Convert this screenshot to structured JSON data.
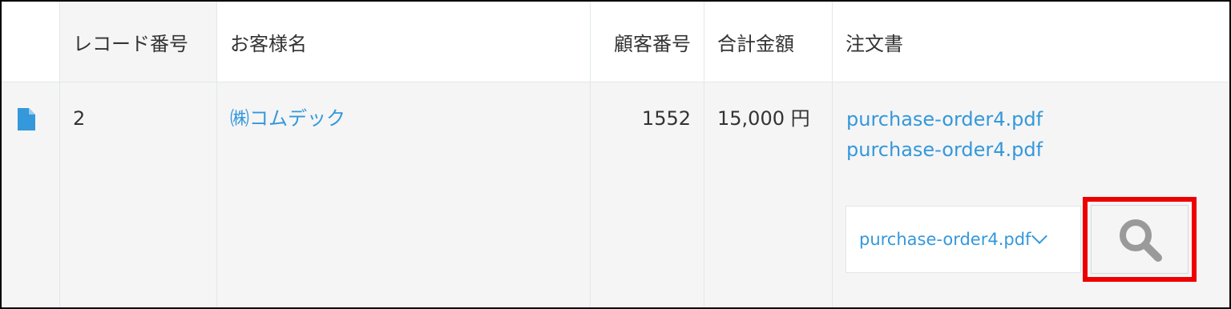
{
  "table": {
    "headers": {
      "record_number": "レコード番号",
      "customer_name": "お客様名",
      "customer_number": "顧客番号",
      "total_amount": "合計金額",
      "purchase_order": "注文書"
    },
    "row": {
      "record_number": "2",
      "customer_name": "㈱コムデック",
      "customer_number": "1552",
      "total_amount": "15,000 円",
      "files": [
        "purchase-order4.pdf",
        "purchase-order4.pdf"
      ],
      "file_select_value": "purchase-order4.pdf"
    }
  },
  "icons": {
    "record": "document-icon",
    "preview": "search-icon"
  },
  "colors": {
    "link": "#3498db",
    "highlight": "#ee0000",
    "row_background": "#f5f5f5",
    "border": "#e3e7e8"
  }
}
